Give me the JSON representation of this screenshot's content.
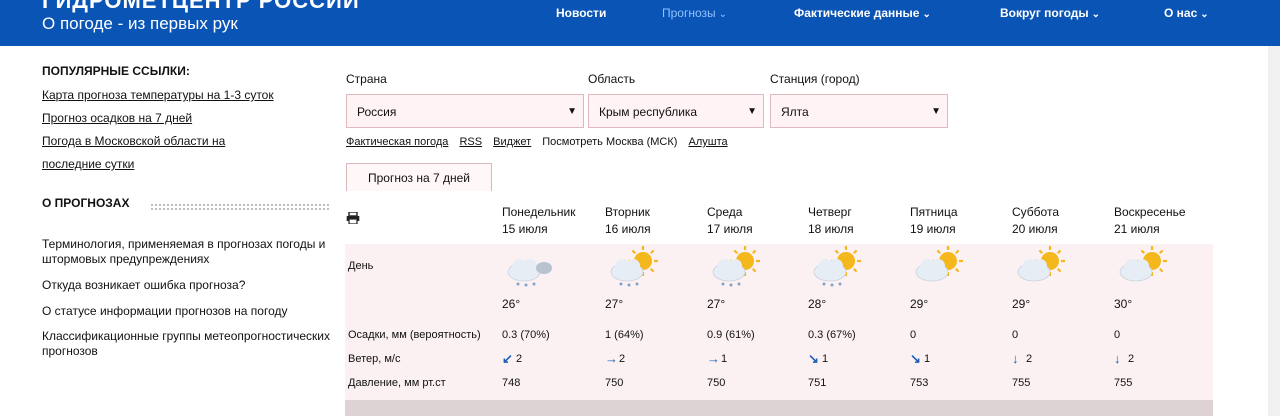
{
  "header": {
    "title": "ГИДРОМЕТЦЕНТР РОССИИ",
    "subtitle": "О погоде - из первых рук",
    "nav": [
      {
        "label": "Новости",
        "has_menu": false
      },
      {
        "label": "Прогнозы",
        "has_menu": true,
        "active": true
      },
      {
        "label": "Фактические данные",
        "has_menu": true
      },
      {
        "label": "Вокруг погоды",
        "has_menu": true
      },
      {
        "label": "О нас",
        "has_menu": true
      }
    ]
  },
  "sidebar": {
    "popular_title": "ПОПУЛЯРНЫЕ ССЫЛКИ:",
    "popular_links": [
      "Карта прогноза температуры на 1-3 суток",
      "Прогноз осадков на 7 дней",
      "Погода в Московской области на последние сутки"
    ],
    "about_title": "О ПРОГНОЗАХ",
    "about_links": [
      "Терминология, применяемая в прогнозах погоды и штормовых предупреждениях",
      "Откуда возникает ошибка прогноза?",
      "О статусе информации прогнозов на погоду",
      "Классификационные группы метеопрогностических прогнозов"
    ]
  },
  "filters": {
    "country_label": "Страна",
    "country_value": "Россия",
    "region_label": "Область",
    "region_value": "Крым республика",
    "station_label": "Станция (город)",
    "station_value": "Ялта"
  },
  "mini_links": [
    "Фактическая погода",
    "RSS",
    "Виджет",
    "Посмотреть Москва (МСК)",
    "Алушта"
  ],
  "tab_label": "Прогноз на 7 дней",
  "forecast": {
    "day_row_label": "День",
    "precip_label": "Осадки, мм (вероятность)",
    "wind_label": "Ветер, м/с",
    "pressure_label": "Давление, мм рт.ст",
    "days": [
      {
        "name": "Понедельник",
        "date": "15 июля",
        "temp": "26°",
        "precip": "0.3 (70%)",
        "wind_arrow": "↙",
        "wind": "2",
        "pressure": "748",
        "icon": "cloud-rain-icon"
      },
      {
        "name": "Вторник",
        "date": "16 июля",
        "temp": "27°",
        "precip": "1 (64%)",
        "wind_arrow": "→",
        "wind": "2",
        "pressure": "750",
        "icon": "sun-cloud-rain-icon"
      },
      {
        "name": "Среда",
        "date": "17 июля",
        "temp": "27°",
        "precip": "0.9 (61%)",
        "wind_arrow": "→",
        "wind": "1",
        "pressure": "750",
        "icon": "sun-cloud-rain-icon"
      },
      {
        "name": "Четверг",
        "date": "18 июля",
        "temp": "28°",
        "precip": "0.3 (67%)",
        "wind_arrow": "↘",
        "wind": "1",
        "pressure": "751",
        "icon": "sun-cloud-rain-icon"
      },
      {
        "name": "Пятница",
        "date": "19 июля",
        "temp": "29°",
        "precip": "0",
        "wind_arrow": "↘",
        "wind": "1",
        "pressure": "753",
        "icon": "sun-cloud-icon"
      },
      {
        "name": "Суббота",
        "date": "20 июля",
        "temp": "29°",
        "precip": "0",
        "wind_arrow": "↓",
        "wind": "2",
        "pressure": "755",
        "icon": "sun-cloud-icon"
      },
      {
        "name": "Воскресенье",
        "date": "21 июля",
        "temp": "30°",
        "precip": "0",
        "wind_arrow": "↓",
        "wind": "2",
        "pressure": "755",
        "icon": "sun-cloud-icon"
      }
    ]
  },
  "colors": {
    "header": "#0a54b5",
    "panel": "#fcf1f2",
    "sun": "#f5b81c",
    "cloud": "#e6edf5",
    "arrow": "#1b5fb8"
  }
}
